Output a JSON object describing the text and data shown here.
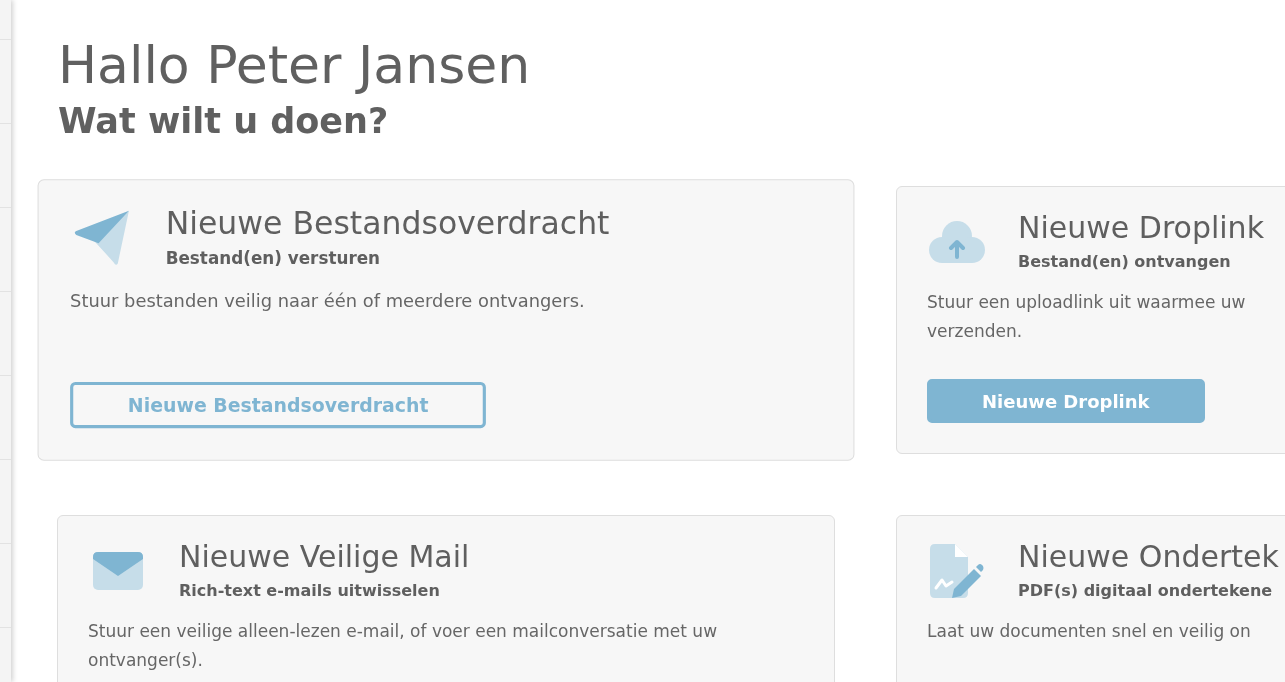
{
  "greeting": "Hallo Peter Jansen",
  "prompt": "Wat wilt u doen?",
  "cards": [
    {
      "kind": "transfer",
      "hovered": true,
      "title": "Nieuwe Bestandsoverdracht",
      "subtitle": "Bestand(en) versturen",
      "description": [
        "Stuur bestanden veilig naar één of meerdere ontvangers."
      ],
      "button": "Nieuwe Bestandsoverdracht"
    },
    {
      "kind": "droplink",
      "hovered": false,
      "title": "Nieuwe Droplink",
      "subtitle": "Bestand(en) ontvangen",
      "description": [
        "Stuur een uploadlink uit waarmee uw",
        "verzenden."
      ],
      "button": "Nieuwe Droplink"
    },
    {
      "kind": "mail",
      "hovered": false,
      "title": "Nieuwe Veilige Mail",
      "subtitle": "Rich-text e-mails uitwisselen",
      "description": [
        "Stuur een veilige alleen-lezen e-mail, of voer een mailconversatie met uw",
        "ontvanger(s)."
      ]
    },
    {
      "kind": "sign",
      "hovered": false,
      "title": "Nieuwe Ondertek",
      "subtitle": "PDF(s) digitaal ondertekene",
      "description": [
        "Laat uw documenten snel en veilig on"
      ]
    }
  ]
}
